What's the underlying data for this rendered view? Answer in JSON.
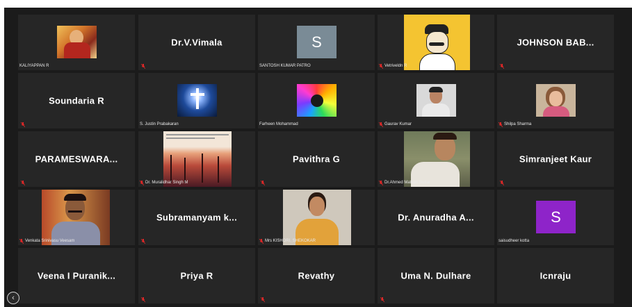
{
  "participants": [
    {
      "name": "KALIYAPPAN R"
    },
    {
      "name": "Dr.V.Vimala"
    },
    {
      "name": "SANTOSH KUMAR PATRO",
      "avatar_letter": "S"
    },
    {
      "name": "Vetriveldn R"
    },
    {
      "name": "JOHNSON BAB..."
    },
    {
      "name": "Soundaria R"
    },
    {
      "name": "S. Justin Prabakaran"
    },
    {
      "name": "Farheen Mohammad"
    },
    {
      "name": "Gaurav Kumar"
    },
    {
      "name": "Shilpa Sharma"
    },
    {
      "name": "PARAMESWARA..."
    },
    {
      "name": "Dr. Muralidhar Singh M"
    },
    {
      "name": "Pavithra G"
    },
    {
      "name": "Dr.Ahmed Mateen Buttar"
    },
    {
      "name": "Simranjeet Kaur"
    },
    {
      "name": "Venkata Srinivasu Veesam"
    },
    {
      "name": "Subramanyam k..."
    },
    {
      "name": "Mrs KISHORI. SHEKOKAR"
    },
    {
      "name": "Dr. Anuradha A..."
    },
    {
      "name": "saisudheer kotta",
      "avatar_letter": "S"
    },
    {
      "name": "Veena I Puranik..."
    },
    {
      "name": "Priya R"
    },
    {
      "name": "Revathy"
    },
    {
      "name": "Uma N. Dulhare"
    },
    {
      "name": "Icnraju"
    }
  ],
  "colors": {
    "gallery_bg": "#1b1b1b",
    "tile_bg": "#262626",
    "mute_red": "#e02828",
    "avatar_grey": "#7a8b96",
    "avatar_purple": "#8e24c9"
  },
  "icons": {
    "back": "chevron-left-icon",
    "mute": "muted-microphone-icon"
  },
  "back_glyph": "‹"
}
